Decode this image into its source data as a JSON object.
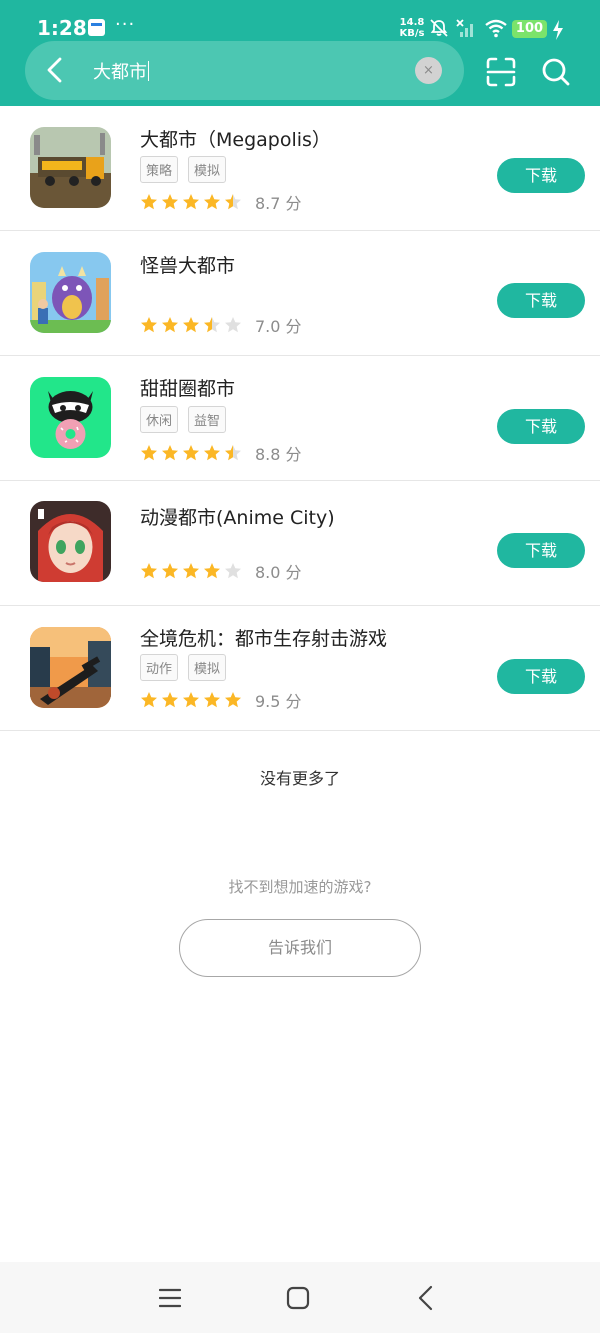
{
  "status": {
    "time": "1:28",
    "dots": "···",
    "net_speed_value": "14.8",
    "net_speed_unit": "KB/s",
    "battery": "100",
    "icons": [
      "app-notification-icon",
      "mute-icon",
      "signal-icon",
      "wifi-icon",
      "charging-icon"
    ]
  },
  "search": {
    "query": "大都市",
    "clear_symbol": "×"
  },
  "apps": [
    {
      "name": "大都市（Megapolis）",
      "tags": [
        "策略",
        "模拟"
      ],
      "rating": 4.5,
      "score": "8.7 分",
      "download": "下载",
      "icon_colors": [
        "#b8c7b0",
        "#5a4a30",
        "#f2b51c"
      ]
    },
    {
      "name": "怪兽大都市",
      "tags": [],
      "rating": 3.5,
      "score": "7.0 分",
      "download": "下载",
      "icon_colors": [
        "#87c8ef",
        "#7d55b8",
        "#f0c34d"
      ]
    },
    {
      "name": "甜甜圈都市",
      "tags": [
        "休闲",
        "益智"
      ],
      "rating": 4.5,
      "score": "8.8 分",
      "download": "下载",
      "icon_colors": [
        "#22e68a",
        "#1e1e1e",
        "#f0a0b4"
      ]
    },
    {
      "name": "动漫都市(Anime City)",
      "tags": [],
      "rating": 4,
      "score": "8.0 分",
      "download": "下载",
      "icon_colors": [
        "#cf3c32",
        "#f6d9c7",
        "#3e2c2a"
      ]
    },
    {
      "name": "全境危机：都市生存射击游戏",
      "tags": [
        "动作",
        "模拟"
      ],
      "rating": 5,
      "score": "9.5 分",
      "download": "下载",
      "icon_colors": [
        "#f09a4a",
        "#283b4b",
        "#1d1d1d"
      ]
    }
  ],
  "footer": {
    "no_more": "没有更多了",
    "cant_find": "找不到想加速的游戏?",
    "tell_us": "告诉我们"
  },
  "theme": {
    "accent": "#20b7a0",
    "star": "#fbb725",
    "star_empty": "#e0e0e0"
  }
}
